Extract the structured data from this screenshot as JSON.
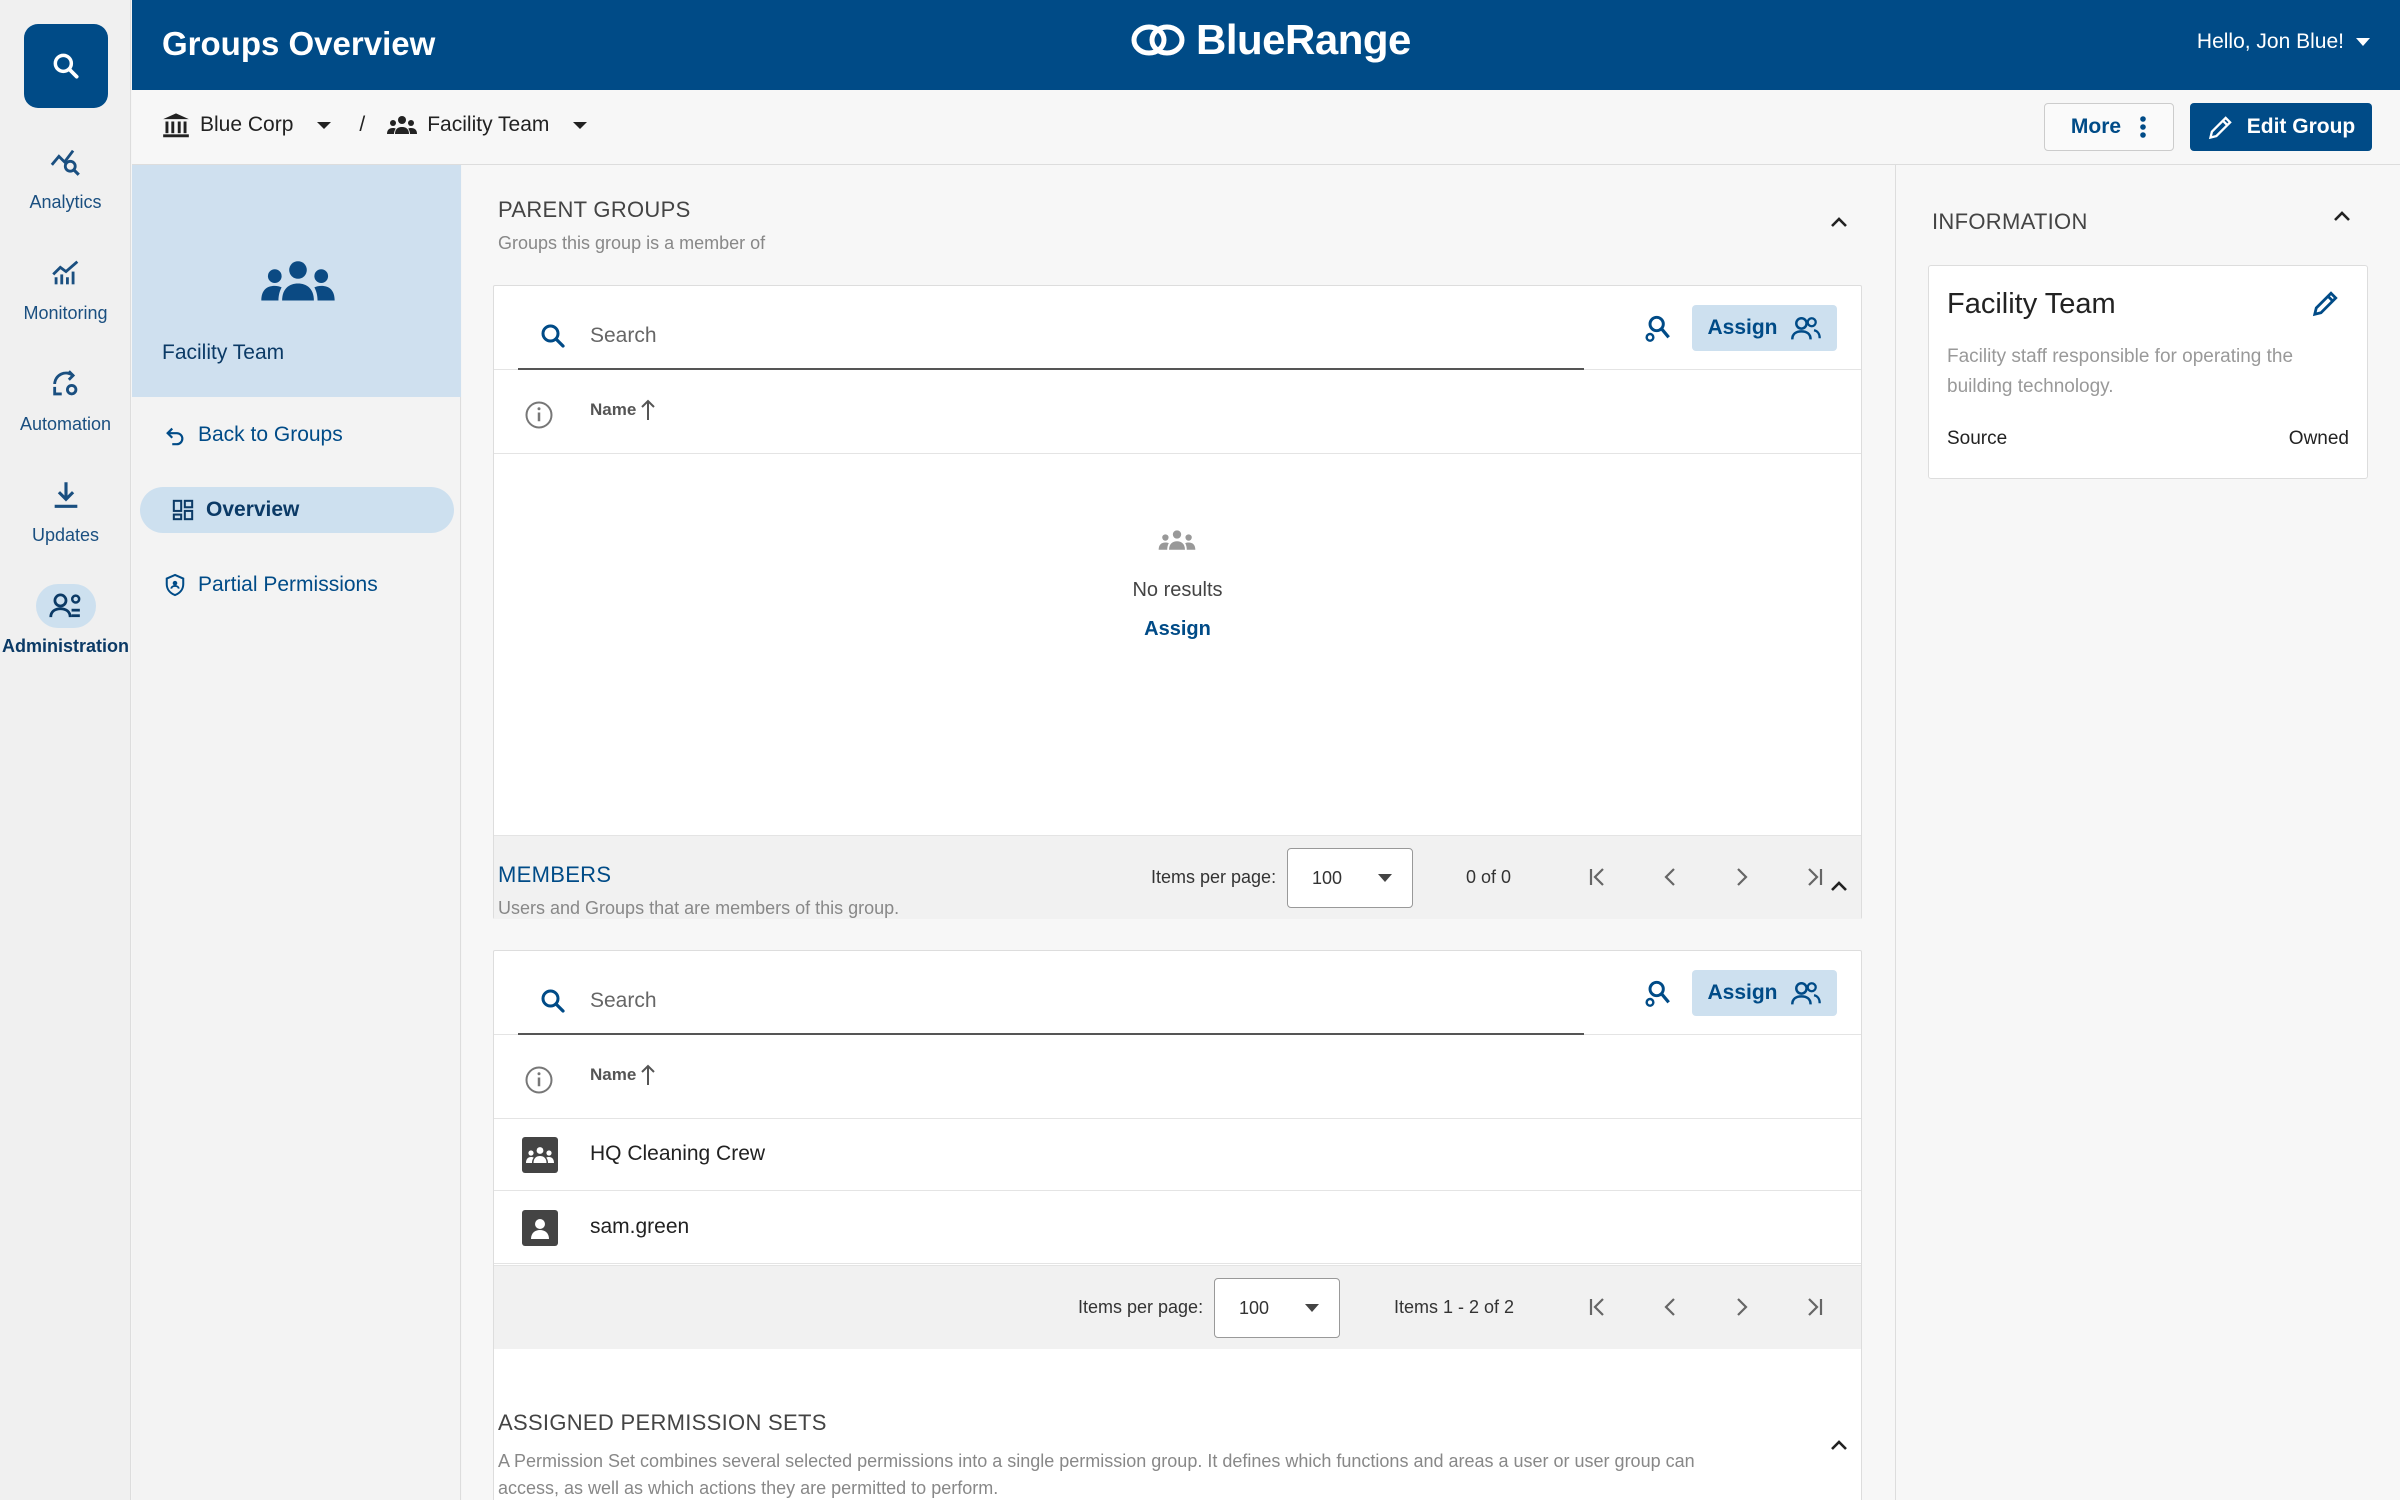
{
  "header": {
    "title": "Groups Overview",
    "brand": "BlueRange",
    "user_greeting": "Hello, Jon Blue!"
  },
  "rail": {
    "items": [
      {
        "label": "Analytics",
        "icon": "analytics-icon"
      },
      {
        "label": "Monitoring",
        "icon": "monitoring-icon"
      },
      {
        "label": "Automation",
        "icon": "automation-icon"
      },
      {
        "label": "Updates",
        "icon": "updates-icon"
      },
      {
        "label": "Administration",
        "icon": "administration-icon",
        "active": true
      }
    ]
  },
  "breadcrumb": {
    "org": "Blue Corp",
    "separator": "/",
    "group": "Facility Team"
  },
  "toolbar": {
    "more_label": "More",
    "edit_label": "Edit Group"
  },
  "group_nav": {
    "group_name": "Facility Team",
    "items": [
      {
        "label": "Back to Groups"
      },
      {
        "label": "Overview",
        "active": true
      },
      {
        "label": "Partial Permissions"
      }
    ]
  },
  "parent_groups": {
    "title": "PARENT GROUPS",
    "subtitle": "Groups this group is a member of",
    "search_placeholder": "Search",
    "assign_label": "Assign",
    "col_name": "Name",
    "empty_text": "No results",
    "empty_action": "Assign",
    "items_per_page_label": "Items per page:",
    "items_per_page": "100",
    "count": "0 of 0"
  },
  "members": {
    "title": "MEMBERS",
    "subtitle": "Users and Groups that are members of this group.",
    "search_placeholder": "Search",
    "assign_label": "Assign",
    "col_name": "Name",
    "rows": [
      {
        "name": "HQ Cleaning Crew",
        "type": "group"
      },
      {
        "name": "sam.green",
        "type": "user"
      }
    ],
    "items_per_page_label": "Items per page:",
    "items_per_page": "100",
    "count": "Items 1 - 2 of 2"
  },
  "permission_sets": {
    "title": "ASSIGNED PERMISSION SETS",
    "subtitle": "A Permission Set combines several selected permissions into a single permission group. It defines which functions and areas a user or user group can access, as well as which actions they are permitted to perform."
  },
  "information": {
    "title": "INFORMATION",
    "name": "Facility Team",
    "description": "Facility staff responsible for operating the building technology.",
    "source_label": "Source",
    "source_value": "Owned"
  },
  "colors": {
    "primary": "#004b87",
    "accent_light": "#cde0ef"
  }
}
